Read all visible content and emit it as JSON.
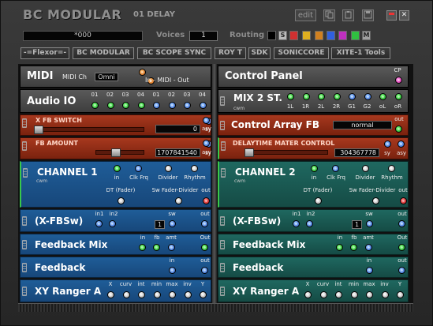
{
  "app": {
    "title": "BC MODULAR",
    "preset_number": "01",
    "preset_name": "DELAY"
  },
  "toolbar": {
    "edit_label": "edit"
  },
  "preset_field": "*000",
  "voices": {
    "label": "Voices",
    "value": "1"
  },
  "routing": {
    "label": "Routing",
    "letters": [
      "S",
      "M"
    ],
    "colors": [
      "#000000",
      "#d03030",
      "#e0b020",
      "#d08020",
      "#3060e0",
      "#c030c0",
      "#30c040",
      "#a0a0a0"
    ]
  },
  "links": [
    "-=Flexor=-",
    "BC MODULAR",
    "BC SCOPE SYNC",
    "ROY T",
    "SDK",
    "SONICCORE",
    "XITE-1 Tools"
  ],
  "left": {
    "midi": {
      "title": "MIDI",
      "ch_label": "MIDI Ch",
      "ch_value": "Omni",
      "io_label": "In - MIDI - Out"
    },
    "audio_io": {
      "title": "Audio IO",
      "ports": [
        "01",
        "02",
        "03",
        "04",
        "01",
        "02",
        "03",
        "04"
      ]
    },
    "fb_switch": {
      "title": "X FB SWITCH",
      "value": "0",
      "ports": [
        "sy",
        "asy"
      ]
    },
    "fb_amount": {
      "title": "FB AMOUNT",
      "value": "1707841540",
      "ports": [
        "sy",
        "asy"
      ]
    },
    "channel": {
      "title": "CHANNEL 1",
      "tag": "cwm",
      "inputs": [
        "in",
        "Clk Frq",
        "Divider",
        "Rhythm"
      ],
      "outputs": [
        "DT (Fader)",
        "Sw Fader-Divider",
        "out"
      ]
    },
    "xfbsw": {
      "title": "(X-FBSw)",
      "ports": [
        "in1",
        "in2",
        "sw",
        "out"
      ],
      "value": "1"
    },
    "fbmix": {
      "title": "Feedback Mix",
      "ports": [
        "in",
        "fb",
        "amt",
        "Out"
      ]
    },
    "feedback": {
      "title": "Feedback",
      "ports": [
        "in",
        "out"
      ]
    },
    "xyranger": {
      "title": "XY Ranger A",
      "ports": [
        "X",
        "curv",
        "int",
        "min",
        "max",
        "inv",
        "Y"
      ]
    }
  },
  "right": {
    "control_panel": {
      "title": "Control Panel",
      "port": "CP"
    },
    "mix2": {
      "title": "MIX 2 ST.",
      "tag": "cwm",
      "ports": [
        "1L",
        "1R",
        "2L",
        "2R",
        "G1",
        "G2",
        "oL",
        "oR"
      ]
    },
    "ctrl_array": {
      "title": "Control Array FB",
      "value": "normal",
      "port": "out"
    },
    "delaytime": {
      "title": "DELAYTIME MATER CONTROL",
      "value": "304367778",
      "ports": [
        "sy",
        "asy"
      ]
    },
    "channel": {
      "title": "CHANNEL 2",
      "tag": "cwm",
      "inputs": [
        "in",
        "Clk Frq",
        "Divider",
        "Rhythm"
      ],
      "outputs": [
        "DT (Fader)",
        "Sw Fader-Divider",
        "out"
      ]
    },
    "xfbsw": {
      "title": "(X-FBSw)",
      "ports": [
        "in1",
        "in2",
        "sw",
        "out"
      ],
      "value": "1"
    },
    "fbmix": {
      "title": "Feedback Mix",
      "ports": [
        "in",
        "fb",
        "amt",
        "Out"
      ]
    },
    "feedback": {
      "title": "Feedback",
      "ports": [
        "in",
        "out"
      ]
    },
    "xyranger": {
      "title": "XY Ranger A",
      "ports": [
        "X",
        "curv",
        "int",
        "min",
        "max",
        "inv",
        "Y"
      ]
    }
  }
}
